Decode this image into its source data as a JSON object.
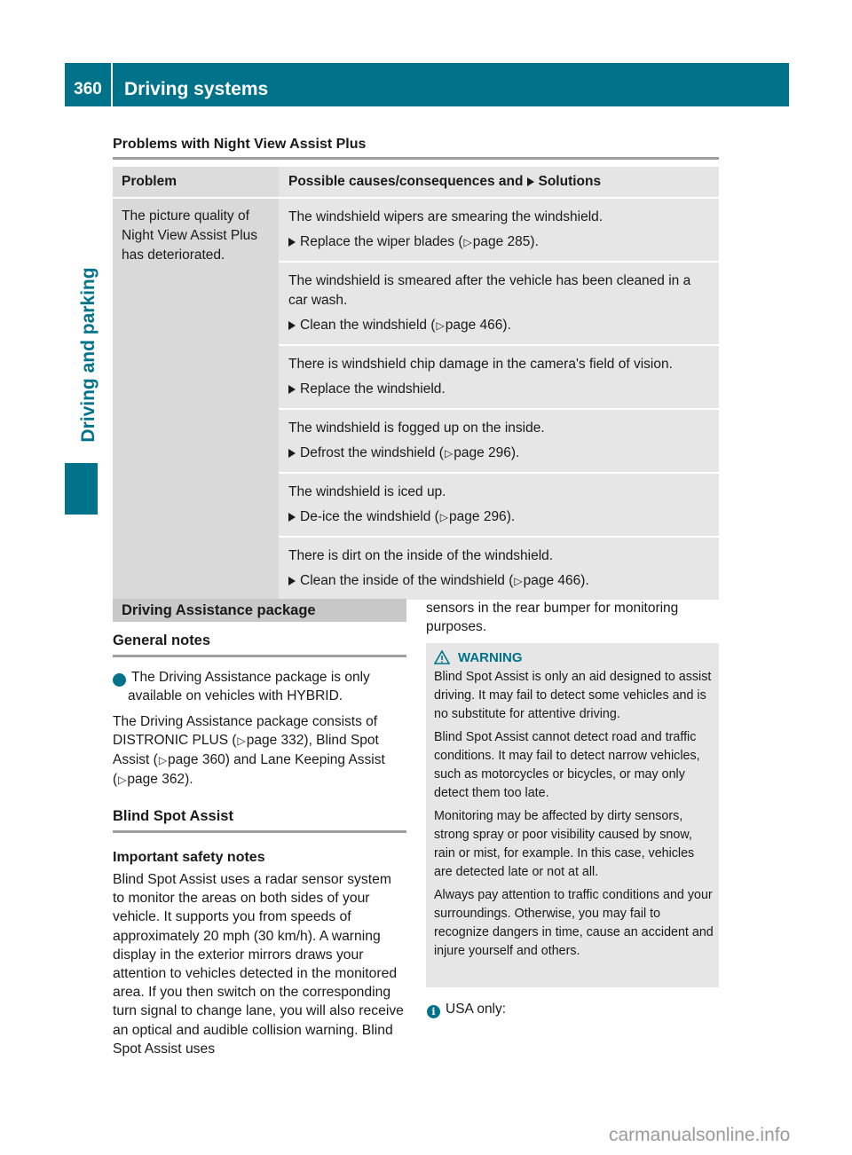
{
  "header": {
    "page_number": "360",
    "chapter_title": "Driving systems",
    "side_tab": "Driving and parking",
    "accent_color": "#00728a"
  },
  "night_view": {
    "title": "Problems with Night View Assist Plus",
    "columns": {
      "problem": "Problem",
      "causes_prefix": "Possible causes/consequences and",
      "causes_suffix": "Solutions"
    },
    "problem": "The picture quality of Night View Assist Plus has deteriorated.",
    "causes": [
      {
        "cause": "The windshield wipers are smearing the windshield.",
        "solution": "Replace the wiper blades (",
        "ref": "page 285",
        "end": ")."
      },
      {
        "cause": "The windshield is smeared after the vehicle has been cleaned in a car wash.",
        "solution": "Clean the windshield (",
        "ref": "page 466",
        "end": ")."
      },
      {
        "cause": "There is windshield chip damage in the camera's field of vision.",
        "solution": "Replace the windshield.",
        "ref": "",
        "end": ""
      },
      {
        "cause": "The windshield is fogged up on the inside.",
        "solution": "Defrost the windshield (",
        "ref": "page 296",
        "end": ")."
      },
      {
        "cause": "The windshield is iced up.",
        "solution": "De-ice the windshield (",
        "ref": "page 296",
        "end": ")."
      },
      {
        "cause": "There is dirt on the inside of the windshield.",
        "solution": "Clean the inside of the windshield (",
        "ref": "page 466",
        "end": ")."
      }
    ]
  },
  "dap": {
    "band_title": "Driving Assistance package",
    "general_notes": "General notes",
    "info_note": "The Driving Assistance package is only available on vehicles with HYBRID.",
    "consists_1": "The Driving Assistance package consists of DISTRONIC PLUS (",
    "ref_1": "page 332",
    "consists_2": "), Blind Spot Assist (",
    "ref_2": "page 360",
    "consists_3": ") and Lane Keeping Assist (",
    "ref_3": "page 362",
    "consists_4": ").",
    "bsa_title": "Blind Spot Assist",
    "safety_title": "Important safety notes",
    "safety_text": "Blind Spot Assist uses a radar sensor system to monitor the areas on both sides of your vehicle. It supports you from speeds of approximately 20 mph (30 km/h). A warning display in the exterior mirrors draws your attention to vehicles detected in the monitored area. If you then switch on the corresponding turn signal to change lane, you will also receive an optical and audible collision warning. Blind Spot Assist uses",
    "safety_text_cont": "sensors in the rear bumper for monitoring purposes."
  },
  "warning": {
    "label": "WARNING",
    "paragraphs": [
      "Blind Spot Assist is only an aid designed to assist driving. It may fail to detect some vehicles and is no substitute for attentive driving.",
      "Blind Spot Assist cannot detect road and traffic conditions. It may fail to detect narrow vehicles, such as motorcycles or bicycles, or may only detect them too late.",
      "Monitoring may be affected by dirty sensors, strong spray or poor visibility caused by snow, rain or mist, for example. In this case, vehicles are detected late or not at all.",
      "Always pay attention to traffic conditions and your surroundings. Otherwise, you may fail to recognize dangers in time, cause an accident and injure yourself and others."
    ]
  },
  "usa_note": "USA only:",
  "watermark": "carmanualsonline.info",
  "icons": {
    "info": "i",
    "ref_arrow": "▷"
  }
}
